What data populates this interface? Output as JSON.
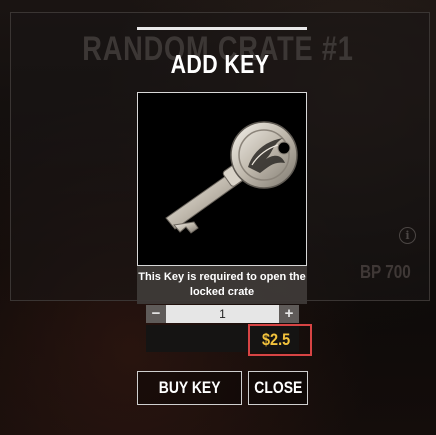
{
  "background": {
    "title": "RANDOM CRATE #1",
    "info_icon": "info-icon",
    "bp_label": "BP 700"
  },
  "modal": {
    "title": "ADD KEY",
    "item_image": "crate-key-image",
    "description": "This Key is required to open the locked crate",
    "quantity": {
      "minus_label": "−",
      "value": "1",
      "plus_label": "+"
    },
    "price": "$2.5",
    "buttons": {
      "buy_label": "BUY KEY",
      "close_label": "CLOSE"
    }
  },
  "colors": {
    "price": "#f2c23c",
    "highlight": "#d74444",
    "text": "#ffffff"
  }
}
